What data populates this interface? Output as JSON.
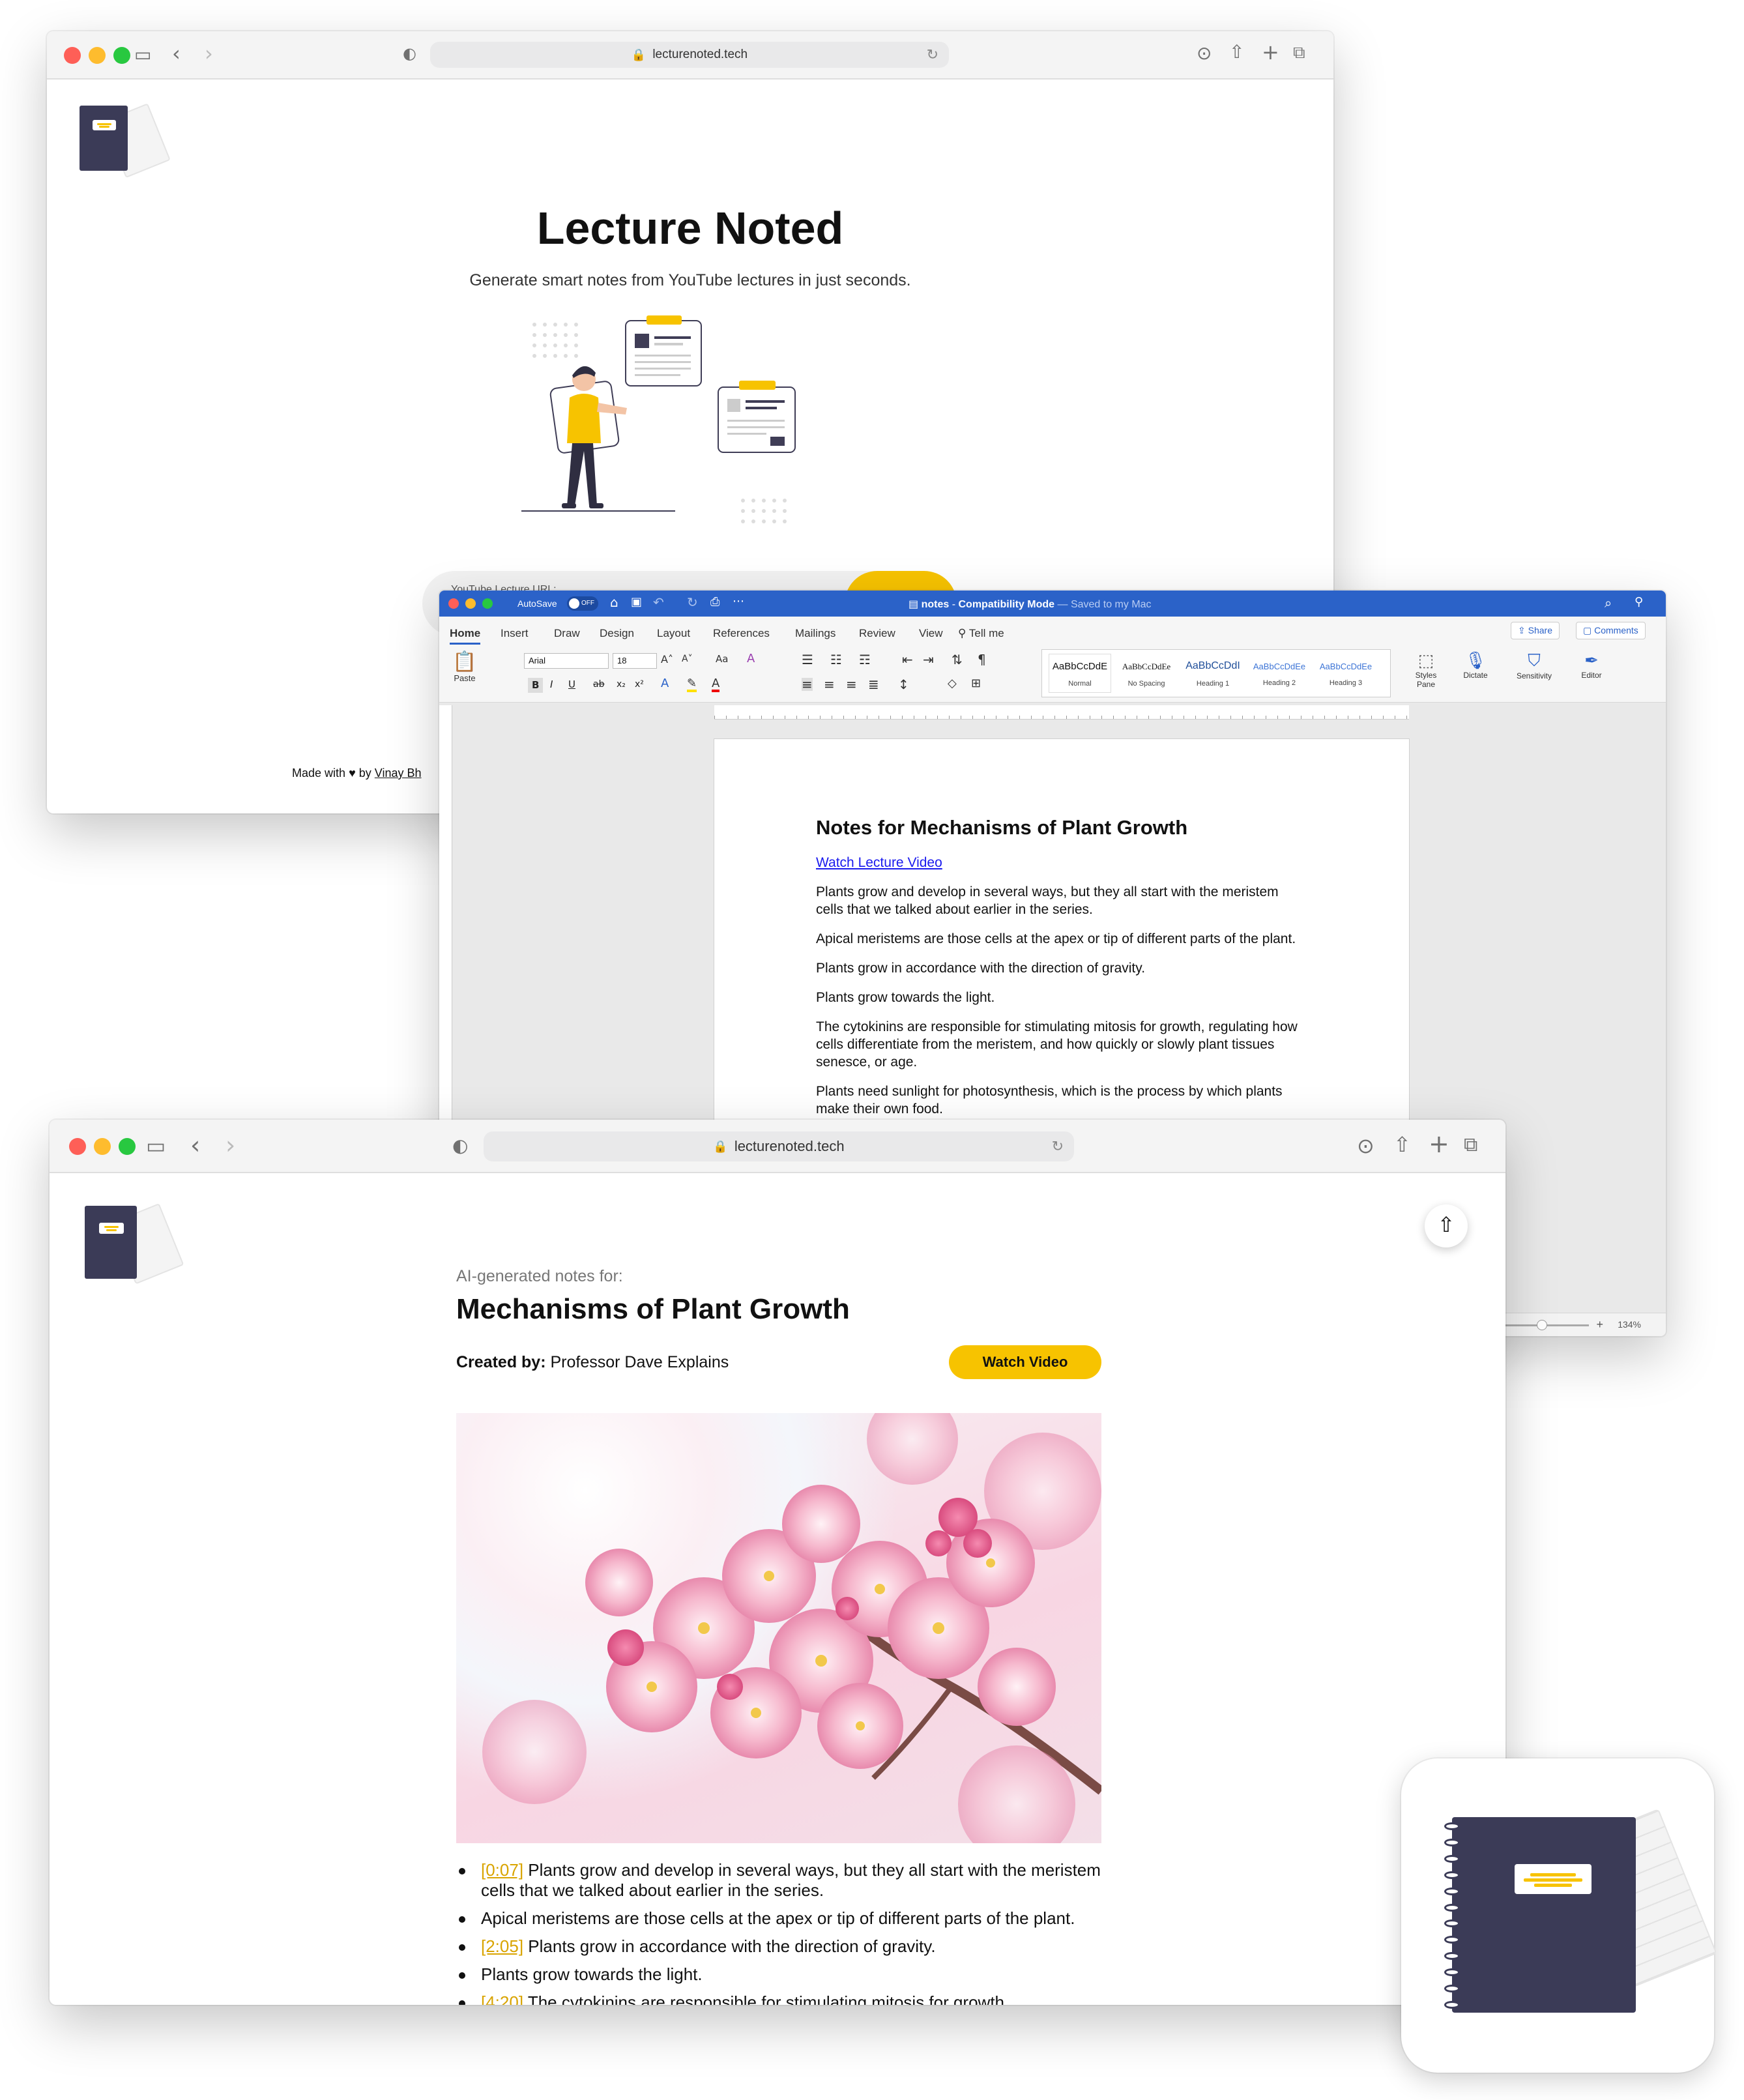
{
  "site": {
    "url": "lecturenoted.tech",
    "title": "Lecture Noted",
    "subtitle": "Generate smart notes from YouTube lectures in just seconds.",
    "input_label": "YouTube Lecture URL:",
    "footer_prefix": "Made with",
    "footer_by": "by",
    "footer_author": "Vinay Bh"
  },
  "word": {
    "autosave_label": "AutoSave",
    "autosave_state": "OFF",
    "doc_name": "notes",
    "mode": "Compatibility Mode",
    "saved": "— Saved to my Mac",
    "tabs": [
      "Home",
      "Insert",
      "Draw",
      "Design",
      "Layout",
      "References",
      "Mailings",
      "Review",
      "View"
    ],
    "tell_me": "Tell me",
    "share": "Share",
    "comments": "Comments",
    "font_name": "Arial",
    "font_size": "18",
    "paste": "Paste",
    "styles": [
      {
        "preview": "AaBbCcDdE",
        "name": "Normal"
      },
      {
        "preview": "AaBbCcDdEe",
        "name": "No Spacing"
      },
      {
        "preview": "AaBbCcDdI",
        "name": "Heading 1"
      },
      {
        "preview": "AaBbCcDdEe",
        "name": "Heading 2"
      },
      {
        "preview": "AaBbCcDdEe",
        "name": "Heading 3"
      }
    ],
    "styles_pane": "Styles Pane",
    "dictate": "Dictate",
    "sensitivity": "Sensitivity",
    "editor": "Editor",
    "zoom": "134%",
    "doc_title": "Notes for Mechanisms of Plant Growth",
    "doc_link": "Watch Lecture Video",
    "paragraphs": [
      "Plants grow and develop in several ways, but they all start with the meristem cells that we talked about earlier in the series.",
      "Apical meristems are those cells at the apex or tip of different parts of the plant.",
      "Plants grow in accordance with the direction of gravity.",
      "Plants grow towards the light.",
      "The cytokinins are responsible for stimulating mitosis for growth, regulating how cells differentiate from the meristem, and how quickly or slowly plant tissues senesce, or age.",
      "Plants need sunlight for photosynthesis, which is the process by which plants make their own food."
    ]
  },
  "notes_page": {
    "url": "lecturenoted.tech",
    "kicker": "AI-generated notes for:",
    "title": "Mechanisms of Plant Growth",
    "created_label": "Created by:",
    "creator": "Professor Dave Explains",
    "watch_button": "Watch Video",
    "bullets": [
      {
        "ts": "[0:07]",
        "text": "Plants grow and develop in several ways, but they all start with the meristem cells that we talked about earlier in the series."
      },
      {
        "ts": "",
        "text": "Apical meristems are those cells at the apex or tip of different parts of the plant."
      },
      {
        "ts": "[2:05]",
        "text": "Plants grow in accordance with the direction of gravity."
      },
      {
        "ts": "",
        "text": "Plants grow towards the light."
      },
      {
        "ts": "[4:20]",
        "text": "The cytokinins are responsible for stimulating mitosis for growth,"
      }
    ]
  },
  "colors": {
    "accent": "#f7c300",
    "word_blue": "#2b62c8",
    "notebook": "#3b3b57"
  }
}
